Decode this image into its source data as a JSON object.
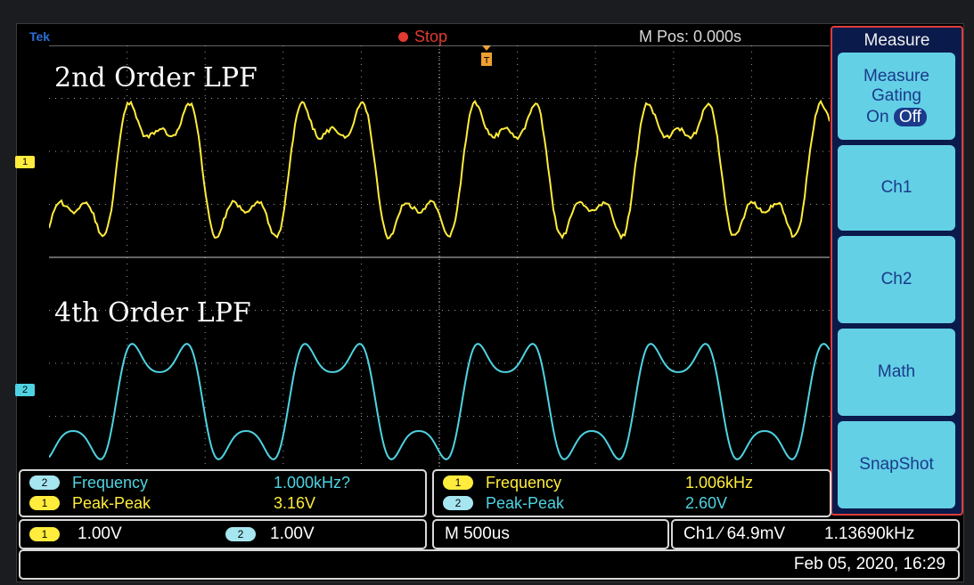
{
  "topbar": {
    "brand": "Tek",
    "acq_state": "Stop",
    "horizontal_position": "M Pos: 0.000s"
  },
  "overlay_labels": {
    "upper": "2nd Order LPF",
    "lower": "4th Order LPF"
  },
  "channel_markers": {
    "ch1": "1",
    "ch2": "2"
  },
  "colors": {
    "ch1": "#ffec3d",
    "ch2": "#4fd3e2",
    "menu_button": "#63d0e6",
    "menu_text": "#1b3a8a",
    "stop": "#e23a32",
    "menu_border": "#e03c3c"
  },
  "side_menu": {
    "title": "Measure",
    "gating": {
      "line1": "Measure",
      "line2": "Gating",
      "on": "On",
      "off": "Off"
    },
    "buttons": [
      "Ch1",
      "Ch2",
      "Math",
      "SnapShot"
    ]
  },
  "measurements_left": [
    {
      "channel": "2",
      "name": "Frequency",
      "value": "1.000kHz?"
    },
    {
      "channel": "1",
      "name": "Peak-Peak",
      "value": "3.16V"
    }
  ],
  "measurements_right": [
    {
      "channel": "1",
      "name": "Frequency",
      "value": "1.006kHz"
    },
    {
      "channel": "2",
      "name": "Peak-Peak",
      "value": "2.60V"
    }
  ],
  "status_bar": {
    "ch1_badge": "1",
    "ch1_scale": "1.00V",
    "ch2_badge": "2",
    "ch2_scale": "1.00V",
    "timebase": "M 500us",
    "trigger": "Ch1 ⁄ 64.9mV",
    "trigger_freq": "1.13690kHz",
    "datetime": "Feb 05, 2020, 16:29"
  }
}
